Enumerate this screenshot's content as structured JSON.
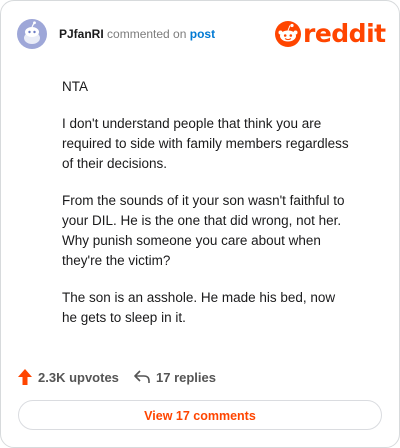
{
  "header": {
    "username": "PJfanRI",
    "action_text": "commented on",
    "post_link": "post",
    "brand": "reddit"
  },
  "comment": {
    "paragraphs": [
      "NTA",
      "I don't understand people that think you are required to side with family members regardless of their decisions.",
      "From the sounds of it your son wasn't faithful to your DIL. He is the one that did wrong, not her. Why punish someone you care about when they're the victim?",
      "The son is an asshole. He made his bed, now he gets to sleep in it."
    ]
  },
  "footer": {
    "upvotes": "2.3K upvotes",
    "replies": "17 replies",
    "view_comments": "View 17 comments"
  },
  "colors": {
    "brand": "#ff4500",
    "link": "#0079d3",
    "avatar_bg": "#9ea7d8"
  }
}
